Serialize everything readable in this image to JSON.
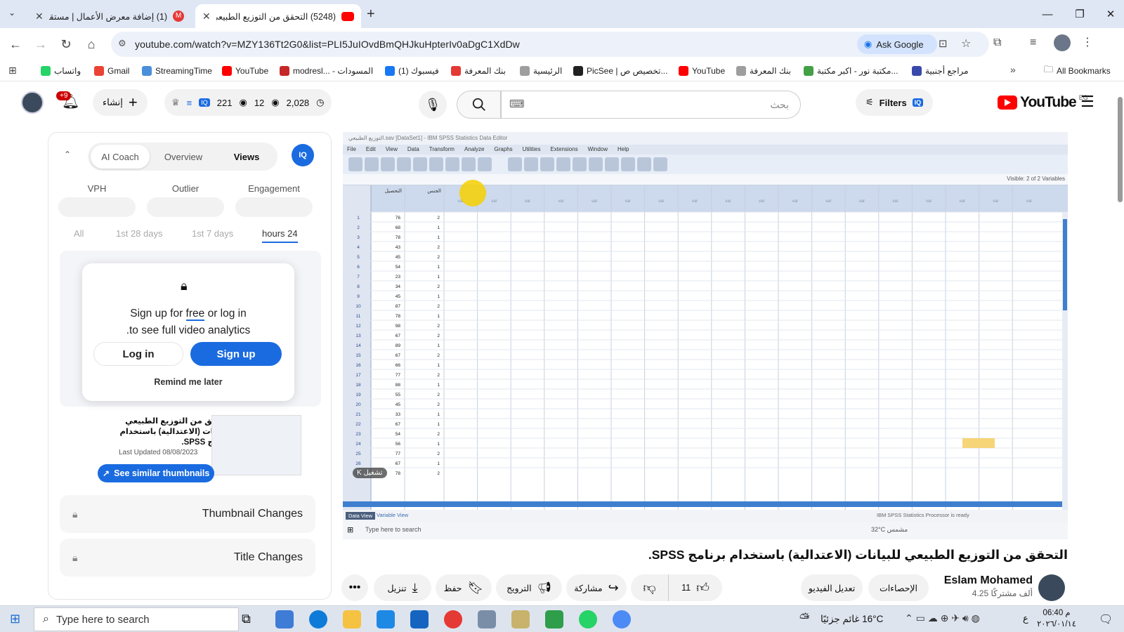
{
  "browser": {
    "tabs": [
      {
        "title": "(1) إضافة معرض الأعمال | مستقل",
        "badge": "1",
        "color": "#e53935",
        "active": false
      },
      {
        "title": "(5248) التحقق من التوزيع الطبيعي",
        "color": "#ff0000",
        "active": true
      }
    ],
    "url": "youtube.com/watch?v=MZY136Tt2G0&list=PLI5JuIOvdBmQHJkuHpterIv0aDgC1XdDw",
    "ask_google": "Ask Google",
    "bookmarks": [
      {
        "label": "واتساب",
        "color": "#25d366"
      },
      {
        "label": "Gmail",
        "color": "#ea4335"
      },
      {
        "label": "StreamingTime",
        "color": "#4a8fd9"
      },
      {
        "label": "YouTube",
        "color": "#ff0000"
      },
      {
        "label": "modresl... - المسودات",
        "color": "#c62828"
      },
      {
        "label": "(1) فيسبوك",
        "color": "#1877f2"
      },
      {
        "label": "بنك المعرفة",
        "color": "#e53935"
      },
      {
        "label": "الرئيسية",
        "color": "#9e9e9e"
      },
      {
        "label": "PicSee | تخصيص ص...",
        "color": "#212121"
      },
      {
        "label": "YouTube",
        "color": "#ff0000"
      },
      {
        "label": "بنك المعرفة",
        "color": "#9e9e9e"
      },
      {
        "label": "مكتبة نور - اكبر مكتبة...",
        "color": "#43a047"
      },
      {
        "label": "مراجع أجنبية",
        "color": "#3949ab"
      }
    ],
    "all_bookmarks": "All Bookmarks"
  },
  "youtube": {
    "search_placeholder": "بحث",
    "filters": "Filters",
    "stats": {
      "views": "2,028",
      "watching": "12",
      "likes": "221"
    },
    "create": "إنشاء",
    "notifications": "+9",
    "logo": "YouTube",
    "region": "EG"
  },
  "panel": {
    "tabs": [
      "AI Coach",
      "Overview",
      "Views"
    ],
    "metrics": [
      "VPH",
      "Outlier",
      "Engagement"
    ],
    "ranges": [
      "All",
      "1st 28 days",
      "1st 7 days",
      "hours 24"
    ],
    "modal": {
      "line1a": "Sign up for ",
      "line1b": "free",
      "line1c": " or log in",
      "line2": ".to see full video analytics",
      "login": "Log in",
      "signup": "Sign up",
      "remind": "Remind me later"
    },
    "thumb": {
      "title": "التحقق من التوزيع الطبيعي للبيانات (الاعتدالية) باستخدام برنامج SPSS.",
      "updated": "Last Updated 08/08/2023",
      "similar": "See similar thumbnails"
    },
    "lock_rows": [
      "Thumbnail Changes",
      "Title Changes"
    ]
  },
  "video": {
    "title": "التحقق من التوزيع الطبيعي للبيانات (الاعتدالية) باستخدام برنامج SPSS.",
    "channel": "Eslam Mohamed",
    "subs": "4.25 ألف مشتركًا",
    "likes": "11",
    "actions": {
      "share": "مشاركة",
      "promote": "الترويج",
      "save": "حفظ",
      "download": "تنزيل",
      "stats": "الإحصاءات",
      "edit": "تعديل الفيديو"
    },
    "spss": {
      "window_title": "التوزيع الطبيعي.sav [DataSet1] - IBM SPSS Statistics Data Editor",
      "menu": [
        "File",
        "Edit",
        "View",
        "Data",
        "Transform",
        "Analyze",
        "Graphs",
        "Utilities",
        "Extensions",
        "Window",
        "Help"
      ],
      "visible": "Visible: 2 of 2 Variables",
      "col1": "التحصيل",
      "col2": "الجنس",
      "var": "var",
      "values": [
        [
          76,
          2
        ],
        [
          68,
          1
        ],
        [
          78,
          1
        ],
        [
          43,
          2
        ],
        [
          45,
          2
        ],
        [
          54,
          1
        ],
        [
          23,
          1
        ],
        [
          34,
          2
        ],
        [
          45,
          1
        ],
        [
          87,
          2
        ],
        [
          78,
          1
        ],
        [
          98,
          2
        ],
        [
          67,
          2
        ],
        [
          89,
          1
        ],
        [
          67,
          2
        ],
        [
          66,
          1
        ],
        [
          77,
          2
        ],
        [
          88,
          1
        ],
        [
          55,
          2
        ],
        [
          45,
          2
        ],
        [
          33,
          1
        ],
        [
          67,
          1
        ],
        [
          54,
          2
        ],
        [
          56,
          1
        ],
        [
          77,
          2
        ],
        [
          67,
          1
        ],
        [
          78,
          2
        ]
      ],
      "variable_view": "Variable View",
      "data_view": "Data View",
      "status": "IBM SPSS Statistics Processor is ready",
      "taskbar_search": "Type here to search",
      "weather": "32°C مشمس"
    }
  },
  "taskbar": {
    "search": "Type here to search",
    "weather": "16°C غائم جزئيًا",
    "time": "06:40 م",
    "date": "٢٠٢٦/٠١/١٤",
    "lang": "ع"
  }
}
